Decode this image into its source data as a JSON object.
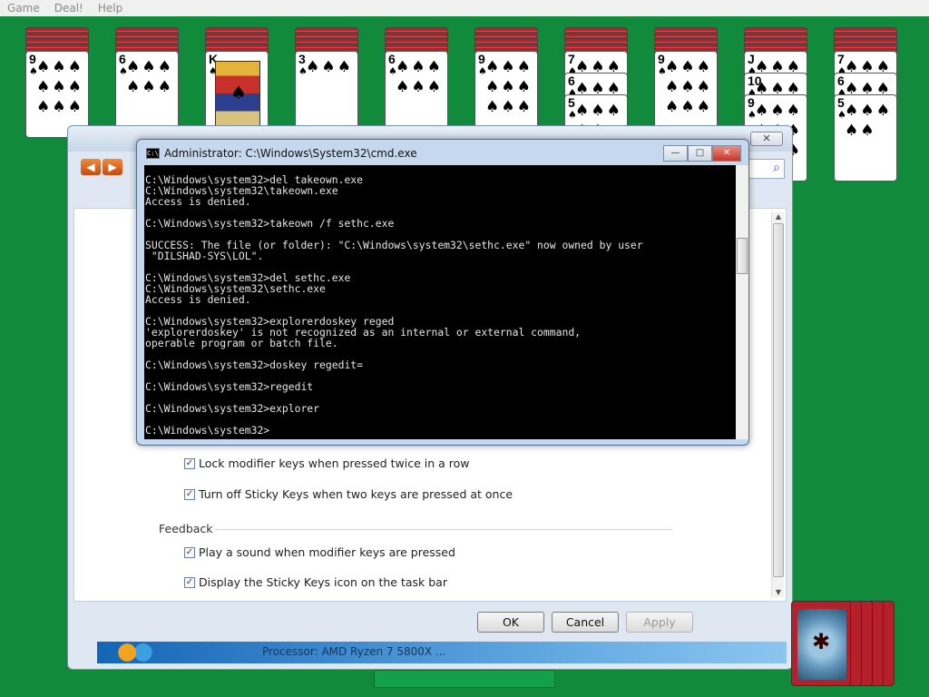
{
  "menu": {
    "items": [
      "Game",
      "Deal!",
      "Help"
    ]
  },
  "tableau": [
    {
      "faceup": [
        {
          "rank": "9",
          "suit": "♠"
        }
      ]
    },
    {
      "faceup": [
        {
          "rank": "6",
          "suit": "♠"
        }
      ]
    },
    {
      "faceup": [
        {
          "rank": "K",
          "suit": "♠",
          "face": true
        }
      ]
    },
    {
      "faceup": [
        {
          "rank": "3",
          "suit": "♠"
        }
      ]
    },
    {
      "faceup": [
        {
          "rank": "6",
          "suit": "♠"
        }
      ]
    },
    {
      "faceup": [
        {
          "rank": "9",
          "suit": "♠"
        }
      ]
    },
    {
      "faceup": [
        {
          "rank": "7",
          "suit": "♠"
        },
        {
          "rank": "6",
          "suit": "♠"
        },
        {
          "rank": "5",
          "suit": "♠"
        }
      ]
    },
    {
      "faceup": [
        {
          "rank": "9",
          "suit": "♠"
        }
      ]
    },
    {
      "faceup": [
        {
          "rank": "J",
          "suit": "♠"
        },
        {
          "rank": "10",
          "suit": "♠"
        },
        {
          "rank": "9",
          "suit": "♠"
        }
      ]
    },
    {
      "faceup": [
        {
          "rank": "7",
          "suit": "♠"
        },
        {
          "rank": "6",
          "suit": "♠"
        },
        {
          "rank": "5",
          "suit": "♠"
        }
      ]
    }
  ],
  "cmd": {
    "title": "Administrator: C:\\Windows\\System32\\cmd.exe",
    "lines": [
      "C:\\Windows\\system32>del takeown.exe",
      "C:\\Windows\\system32\\takeown.exe",
      "Access is denied.",
      "",
      "C:\\Windows\\system32>takeown /f sethc.exe",
      "",
      "SUCCESS: The file (or folder): \"C:\\Windows\\system32\\sethc.exe\" now owned by user",
      " \"DILSHAD-SYS\\LOL\".",
      "",
      "C:\\Windows\\system32>del sethc.exe",
      "C:\\Windows\\system32\\sethc.exe",
      "Access is denied.",
      "",
      "C:\\Windows\\system32>explorerdoskey reged",
      "'explorerdoskey' is not recognized as an internal or external command,",
      "operable program or batch file.",
      "",
      "C:\\Windows\\system32>doskey regedit=",
      "",
      "C:\\Windows\\system32>regedit",
      "",
      "C:\\Windows\\system32>explorer",
      "",
      "C:\\Windows\\system32>"
    ]
  },
  "dialog": {
    "options": {
      "lock_modifier": "Lock modifier keys when pressed twice in a row",
      "turn_off_sticky": "Turn off Sticky Keys when two keys are pressed at once"
    },
    "feedback": {
      "label": "Feedback",
      "play_sound": "Play a sound when modifier keys are pressed",
      "display_icon": "Display the Sticky Keys icon on the task bar"
    },
    "buttons": {
      "ok": "OK",
      "cancel": "Cancel",
      "apply": "Apply"
    },
    "processor": "Processor: AMD Ryzen 7 5800X ..."
  },
  "colors": {
    "felt": "#118a3c",
    "card_back": "#b4212a",
    "console_bg": "#000000"
  }
}
